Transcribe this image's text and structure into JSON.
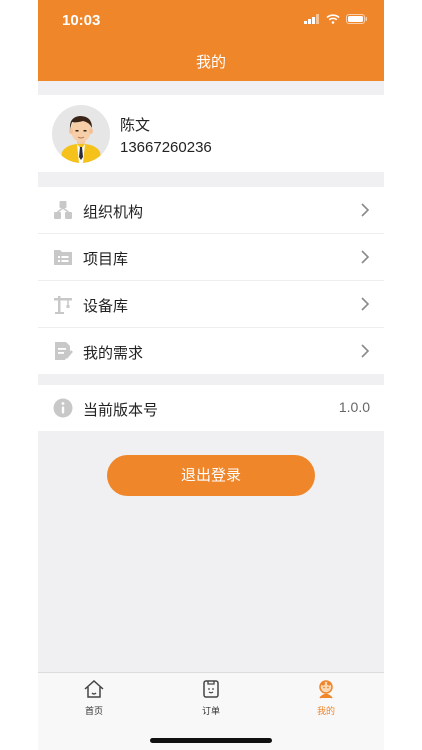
{
  "status_bar": {
    "time": "10:03"
  },
  "header": {
    "title": "我的"
  },
  "profile": {
    "name": "陈文",
    "phone": "13667260236"
  },
  "menu": [
    {
      "label": "组织机构",
      "icon": "organization-icon"
    },
    {
      "label": "项目库",
      "icon": "folder-list-icon"
    },
    {
      "label": "设备库",
      "icon": "crane-icon"
    },
    {
      "label": "我的需求",
      "icon": "document-edit-icon"
    }
  ],
  "version": {
    "label": "当前版本号",
    "value": "1.0.0"
  },
  "logout_label": "退出登录",
  "tabbar": [
    {
      "label": "首页",
      "icon": "home-icon"
    },
    {
      "label": "订单",
      "icon": "order-icon"
    },
    {
      "label": "我的",
      "icon": "profile-icon",
      "active": true
    }
  ],
  "colors": {
    "accent": "#f0862a",
    "background": "#f0f0f2"
  }
}
